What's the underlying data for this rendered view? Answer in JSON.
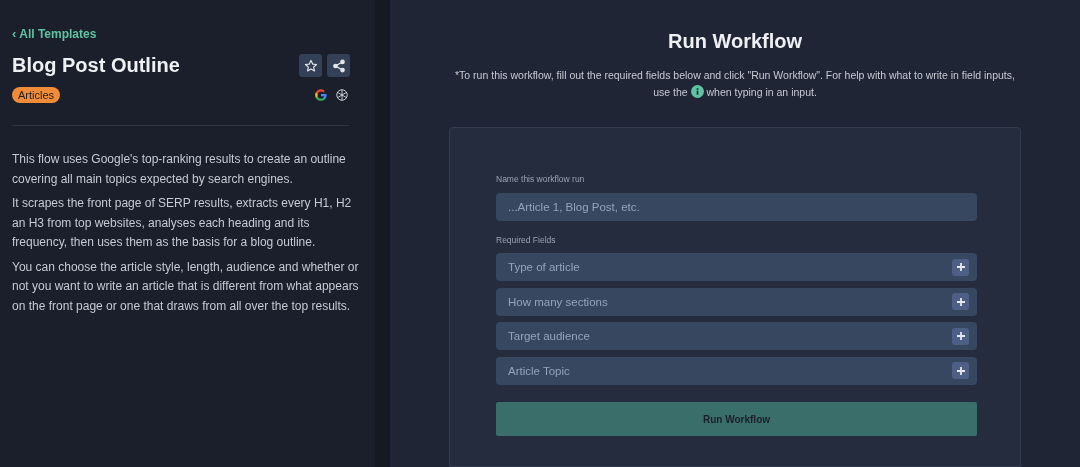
{
  "sidebar": {
    "back_link": {
      "icon": "‹",
      "label": "All Templates"
    },
    "title": "Blog Post Outline",
    "tag": "Articles",
    "paragraphs": [
      "This flow uses Google's top-ranking results to create an outline covering all main topics expected by search engines.",
      "It scrapes the front page of SERP results, extracts every H1, H2 an H3 from top websites, analyses each heading and its frequency, then uses them as the basis for a blog outline.",
      "You can choose the article style, length, audience and whether or not you want to write an article that is different from what appears on the front page or one that draws from all over the top results."
    ]
  },
  "main": {
    "title": "Run Workflow",
    "help_line": "*To run this workflow, fill out the required fields below and click \"Run Workflow\". For help with what to write in field inputs,",
    "help_before": "use the",
    "help_after": "when typing in an input.",
    "form": {
      "name_label": "Name this workflow run",
      "name_placeholder": "...Article 1, Blog Post, etc.",
      "required_label": "Required Fields",
      "fields": [
        {
          "label": "Type of article",
          "expanded": false
        },
        {
          "label": "How many sections",
          "expanded": false
        },
        {
          "label": "Target audience",
          "expanded": false
        },
        {
          "label": "Article Topic",
          "expanded": false
        }
      ],
      "run_button": "Run Workflow"
    }
  }
}
